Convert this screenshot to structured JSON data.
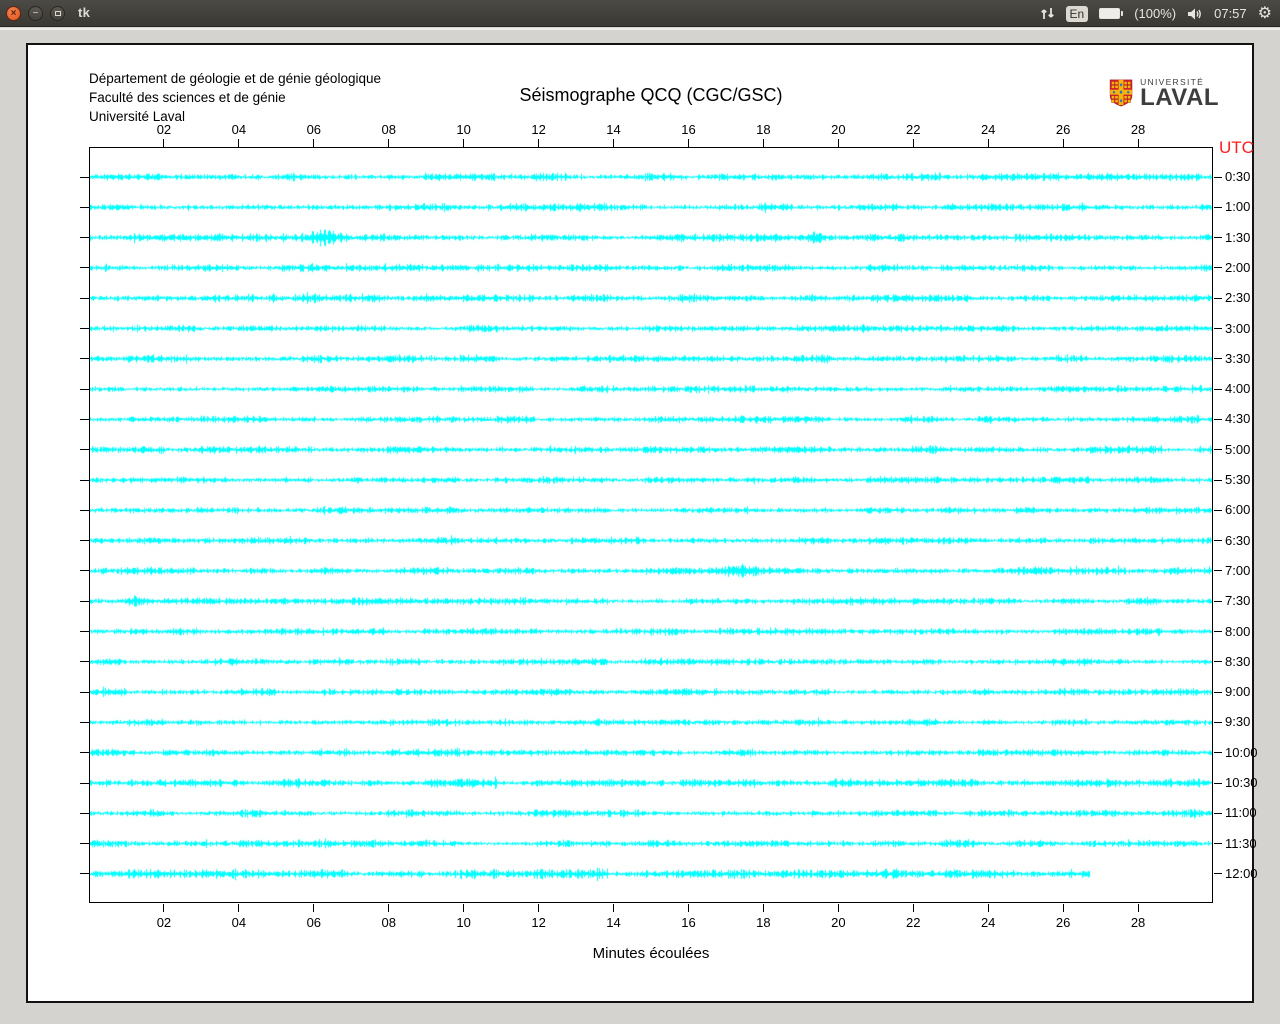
{
  "titlebar": {
    "title": "tk",
    "tray": {
      "keyboard": "En",
      "battery": "(100%)",
      "clock": "07:57"
    }
  },
  "header": {
    "dept_line1": "Département de géologie et de génie géologique",
    "dept_line2": "Faculté des sciences et de génie",
    "dept_line3": "Université Laval",
    "logo_top": "UNIVERSITÉ",
    "logo_bottom": "LAVAL"
  },
  "chart_data": {
    "type": "line",
    "title": "Séismographe QCQ (CGC/GSC)",
    "xlabel": "Minutes écoulées",
    "right_axis_title": "UTC",
    "xlim": [
      0,
      30
    ],
    "minutes_per_row": 30,
    "x_tick_minutes": [
      2,
      4,
      6,
      8,
      10,
      12,
      14,
      16,
      18,
      20,
      22,
      24,
      26,
      28
    ],
    "x_tick_labels": [
      "02",
      "04",
      "06",
      "08",
      "10",
      "12",
      "14",
      "16",
      "18",
      "20",
      "22",
      "24",
      "26",
      "28"
    ],
    "trace_color": "#00ffff",
    "utc_label_color": "#ff1e1e",
    "grid": false,
    "traces": [
      {
        "utc": "0:30",
        "end_minute": 30,
        "amp": 1.0,
        "events": []
      },
      {
        "utc": "1:00",
        "end_minute": 30,
        "amp": 1.0,
        "events": []
      },
      {
        "utc": "1:30",
        "end_minute": 30,
        "amp": 1.05,
        "events": [
          [
            6.2,
            2.0,
            0.5
          ],
          [
            19.3,
            2.6,
            0.15
          ]
        ]
      },
      {
        "utc": "2:00",
        "end_minute": 30,
        "amp": 0.95,
        "events": []
      },
      {
        "utc": "2:30",
        "end_minute": 30,
        "amp": 1.0,
        "events": [
          [
            5.7,
            1.7,
            0.3
          ],
          [
            8.9,
            1.6,
            0.2
          ],
          [
            15.8,
            1.8,
            0.2
          ]
        ]
      },
      {
        "utc": "3:00",
        "end_minute": 30,
        "amp": 0.9,
        "events": []
      },
      {
        "utc": "3:30",
        "end_minute": 30,
        "amp": 1.0,
        "events": [
          [
            6.0,
            1.6,
            0.3
          ]
        ]
      },
      {
        "utc": "4:00",
        "end_minute": 30,
        "amp": 0.9,
        "events": []
      },
      {
        "utc": "4:30",
        "end_minute": 30,
        "amp": 0.95,
        "events": []
      },
      {
        "utc": "5:00",
        "end_minute": 30,
        "amp": 1.0,
        "events": []
      },
      {
        "utc": "5:30",
        "end_minute": 30,
        "amp": 0.9,
        "events": []
      },
      {
        "utc": "6:00",
        "end_minute": 30,
        "amp": 0.9,
        "events": []
      },
      {
        "utc": "6:30",
        "end_minute": 30,
        "amp": 0.95,
        "events": []
      },
      {
        "utc": "7:00",
        "end_minute": 30,
        "amp": 1.0,
        "events": [
          [
            17.3,
            2.4,
            0.35
          ]
        ]
      },
      {
        "utc": "7:30",
        "end_minute": 30,
        "amp": 1.05,
        "events": [
          [
            1.2,
            1.9,
            0.4
          ]
        ]
      },
      {
        "utc": "8:00",
        "end_minute": 30,
        "amp": 0.95,
        "events": []
      },
      {
        "utc": "8:30",
        "end_minute": 30,
        "amp": 0.9,
        "events": []
      },
      {
        "utc": "9:00",
        "end_minute": 30,
        "amp": 0.95,
        "events": [
          [
            23.9,
            2.4,
            0.12
          ]
        ]
      },
      {
        "utc": "9:30",
        "end_minute": 30,
        "amp": 0.9,
        "events": []
      },
      {
        "utc": "10:00",
        "end_minute": 30,
        "amp": 1.0,
        "events": []
      },
      {
        "utc": "10:30",
        "end_minute": 30,
        "amp": 1.15,
        "events": []
      },
      {
        "utc": "11:00",
        "end_minute": 30,
        "amp": 1.0,
        "events": []
      },
      {
        "utc": "11:30",
        "end_minute": 30,
        "amp": 1.0,
        "events": [
          [
            15.1,
            1.7,
            0.3
          ]
        ]
      },
      {
        "utc": "12:00",
        "end_minute": 26.7,
        "amp": 1.3,
        "events": []
      }
    ]
  }
}
